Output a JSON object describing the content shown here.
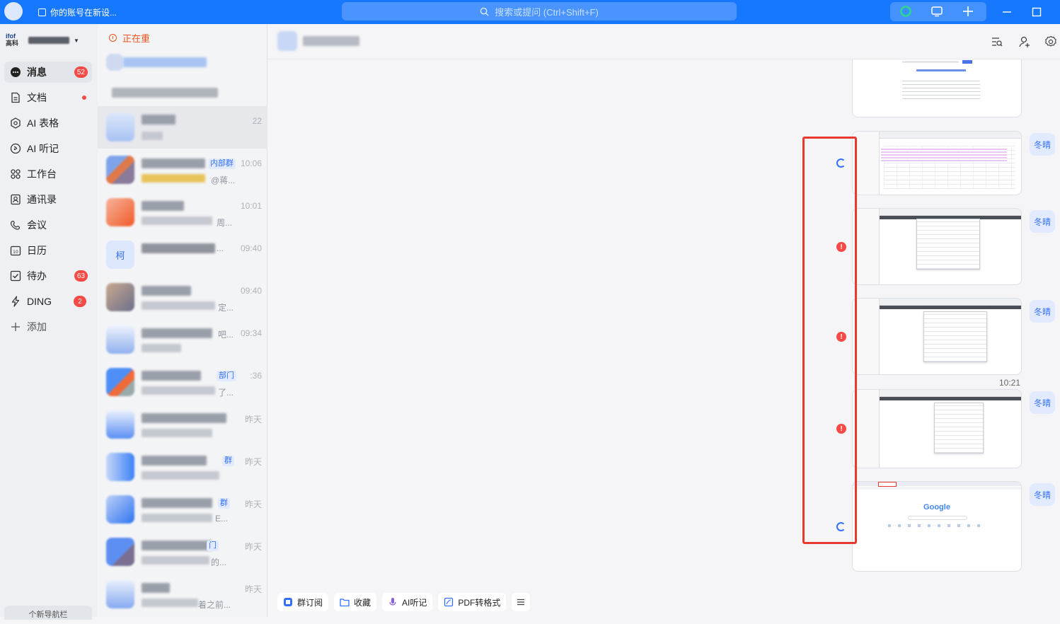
{
  "titlebar": {
    "notice": "你的账号在新设...",
    "search_placeholder": "搜索或提问 (Ctrl+Shift+F)"
  },
  "org": {
    "logo_line1": "ifof",
    "logo_line2": "高科"
  },
  "nav": {
    "items": [
      {
        "label": "消息",
        "badge": "52",
        "icon": "message-icon"
      },
      {
        "label": "文档",
        "icon": "document-icon"
      },
      {
        "label": "AI 表格",
        "icon": "ai-table-icon"
      },
      {
        "label": "AI 听记",
        "icon": "ai-listen-icon"
      },
      {
        "label": "工作台",
        "icon": "workbench-icon"
      },
      {
        "label": "通讯录",
        "icon": "contacts-icon"
      },
      {
        "label": "会议",
        "icon": "meeting-icon"
      },
      {
        "label": "日历",
        "icon": "calendar-icon"
      },
      {
        "label": "待办",
        "badge": "63",
        "icon": "todo-icon"
      },
      {
        "label": "DING",
        "badge": "2",
        "icon": "ding-icon"
      },
      {
        "label": "添加",
        "icon": "plus-icon"
      }
    ],
    "bottom": "个新导航栏"
  },
  "chatlist": {
    "reconnecting": "正在重",
    "rows": [
      {
        "time": ""
      },
      {
        "time": ""
      },
      {
        "time": "22"
      },
      {
        "time": "10:06",
        "tag": "内部群",
        "tail": "@蒋..."
      },
      {
        "time": "10:01",
        "tail": "周..."
      },
      {
        "time": "09:40",
        "avatar_text": "柯",
        "tail": "..."
      },
      {
        "time": "09:40",
        "tail": "定..."
      },
      {
        "time": "09:34",
        "tail": "吧..."
      },
      {
        "time": ":36",
        "tag": "部门",
        "tail": "了..."
      },
      {
        "time": "昨天"
      },
      {
        "time": "昨天",
        "tag": "群"
      },
      {
        "time": "昨天",
        "tag": "群",
        "tail": "E..."
      },
      {
        "time": "昨天",
        "tag": "门",
        "tail": "的..."
      },
      {
        "time": "昨天",
        "tail": "着之前..."
      }
    ]
  },
  "messages": {
    "sender": "冬晴",
    "time_divider": "10:21",
    "google_label": "Google",
    "statuses": [
      "sending",
      "failed",
      "failed",
      "failed",
      "sending"
    ]
  },
  "bottombar": {
    "subscribe": "群订阅",
    "favorite": "收藏",
    "ai_listen": "AI听记",
    "pdf": "PDF转格式"
  },
  "colors": {
    "titlebar": "#1677ff",
    "accent": "#3370ff",
    "error": "#f54a45",
    "highlight_box": "#e8392f"
  }
}
